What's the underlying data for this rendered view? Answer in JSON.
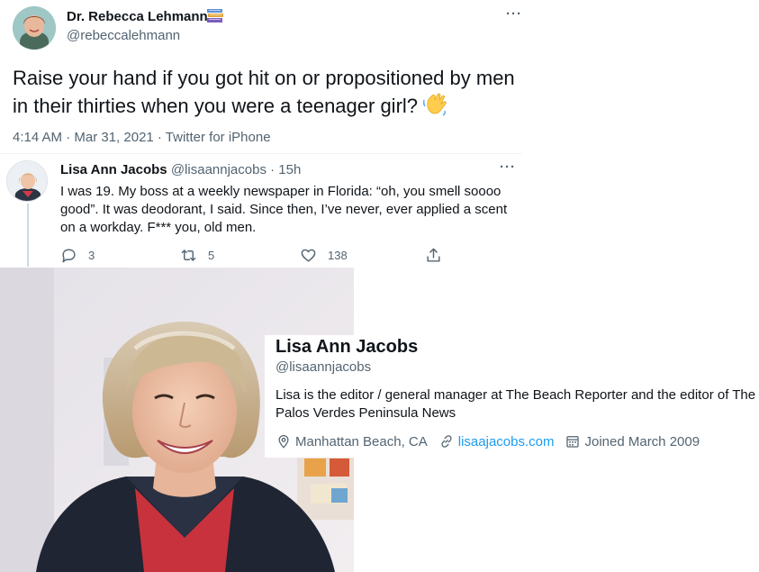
{
  "main_tweet": {
    "author_name": "Dr. Rebecca Lehmann",
    "author_handle": "@rebeccalehmann",
    "text": "Raise your hand if you got hit on or propositioned by men in their thirties when you were a teenager girl?",
    "meta": "4:14 AM · Mar 31, 2021 · Twitter for iPhone",
    "more": "···"
  },
  "reply": {
    "author_name": "Lisa Ann Jacobs",
    "author_handle": "@lisaannjacobs",
    "time": " · 15h",
    "text": "I was 19. My boss at a weekly newspaper  in Florida: “oh, you smell soooo good”. It was deodorant, I said. Since then, I’ve never, ever applied a scent on a workday. F*** you, old men.",
    "more": "···",
    "reply_count": "3",
    "retweet_count": "5",
    "like_count": "138"
  },
  "profile_card": {
    "name": "Lisa Ann Jacobs",
    "handle": "@lisaannjacobs",
    "bio": "Lisa is the editor / general manager at The Beach Reporter and the editor of The Palos Verdes Peninsula News",
    "location": "Manhattan Beach, CA",
    "website": "lisaajacobs.com",
    "joined": "Joined March 2009"
  },
  "colors": {
    "link": "#1d9bf0",
    "secondary_text": "#536471",
    "primary_text": "#0f1419"
  }
}
